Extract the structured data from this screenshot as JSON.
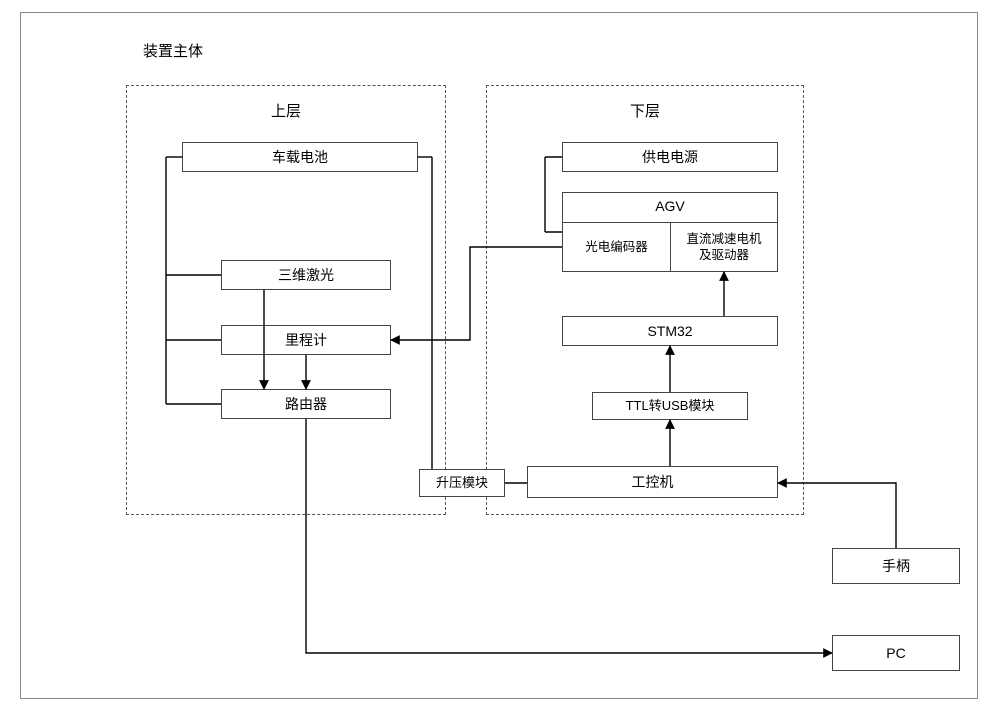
{
  "title": "装置主体",
  "sections": {
    "upper": "上层",
    "lower": "下层"
  },
  "nodes": {
    "battery": "车载电池",
    "lidar3d": "三维激光",
    "odometer": "里程计",
    "router": "路由器",
    "boost": "升压模块",
    "power": "供电电源",
    "agv": "AGV",
    "encoder": "光电编码器",
    "motor": "直流减速电机\n及驱动器",
    "stm32": "STM32",
    "ttl": "TTL转USB模块",
    "ipc": "工控机",
    "handle": "手柄",
    "pc": "PC"
  },
  "chart_data": {
    "type": "block-diagram",
    "description": "Hardware architecture of a mobile robot 装置主体 split into 上层 (upper layer) and 下层 (lower layer) dashed regions, with external 手柄 and PC.",
    "groups": [
      {
        "id": "upper",
        "label": "上层",
        "members": [
          "battery",
          "lidar3d",
          "odometer",
          "router"
        ]
      },
      {
        "id": "lower",
        "label": "下层",
        "members": [
          "power",
          "agv",
          "encoder",
          "motor",
          "stm32",
          "ttl",
          "ipc"
        ]
      },
      {
        "id": "external",
        "label": "external",
        "members": [
          "boost",
          "handle",
          "pc"
        ]
      }
    ],
    "blocks": [
      {
        "id": "battery",
        "label": "车载电池"
      },
      {
        "id": "lidar3d",
        "label": "三维激光"
      },
      {
        "id": "odometer",
        "label": "里程计"
      },
      {
        "id": "router",
        "label": "路由器"
      },
      {
        "id": "boost",
        "label": "升压模块"
      },
      {
        "id": "power",
        "label": "供电电源"
      },
      {
        "id": "agv",
        "label": "AGV",
        "contains": [
          "encoder",
          "motor"
        ]
      },
      {
        "id": "encoder",
        "label": "光电编码器"
      },
      {
        "id": "motor",
        "label": "直流减速电机及驱动器"
      },
      {
        "id": "stm32",
        "label": "STM32"
      },
      {
        "id": "ttl",
        "label": "TTL转USB模块"
      },
      {
        "id": "ipc",
        "label": "工控机"
      },
      {
        "id": "handle",
        "label": "手柄"
      },
      {
        "id": "pc",
        "label": "PC"
      }
    ],
    "edges": [
      {
        "from": "battery",
        "to": "lidar3d",
        "directed": false
      },
      {
        "from": "battery",
        "to": "odometer",
        "directed": false
      },
      {
        "from": "battery",
        "to": "router",
        "directed": false
      },
      {
        "from": "battery",
        "to": "boost",
        "directed": false
      },
      {
        "from": "boost",
        "to": "ipc",
        "directed": false
      },
      {
        "from": "lidar3d",
        "to": "router",
        "directed": true
      },
      {
        "from": "odometer",
        "to": "router",
        "directed": true
      },
      {
        "from": "encoder",
        "to": "odometer",
        "directed": true
      },
      {
        "from": "power",
        "to": "agv",
        "directed": false
      },
      {
        "from": "ipc",
        "to": "ttl",
        "directed": true
      },
      {
        "from": "ttl",
        "to": "stm32",
        "directed": true
      },
      {
        "from": "stm32",
        "to": "motor",
        "directed": true
      },
      {
        "from": "handle",
        "to": "ipc",
        "directed": true
      },
      {
        "from": "router",
        "to": "pc",
        "directed": true
      }
    ]
  }
}
